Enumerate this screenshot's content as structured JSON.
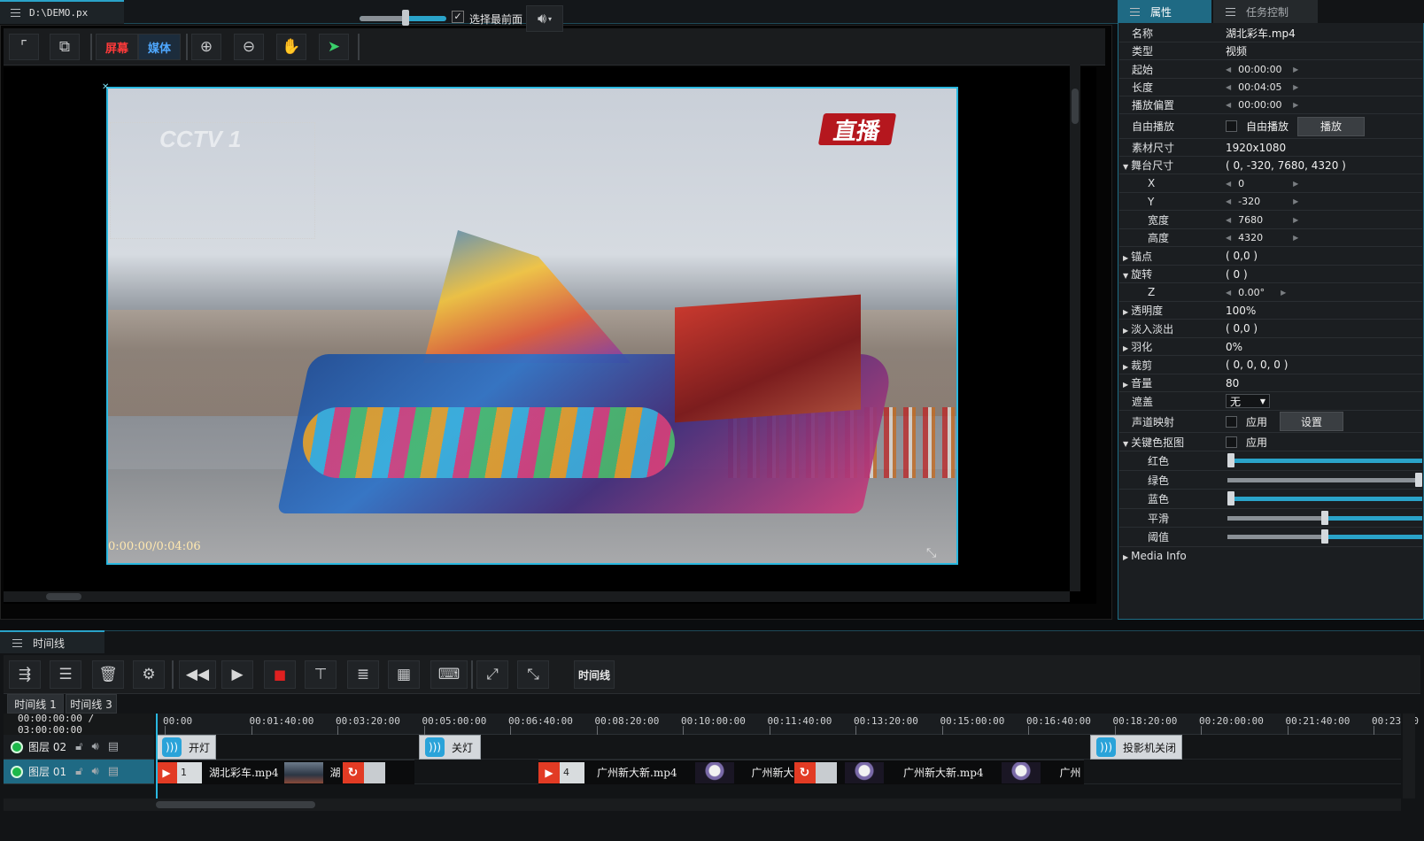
{
  "document_tab": {
    "title": "D:\\DEMO.px"
  },
  "toolbar": {
    "screen_label": "屏幕",
    "media_label": "媒体",
    "zoom_level_fraction": 0.5,
    "select_front_label": "选择最前面",
    "select_front_checked": true
  },
  "preview": {
    "timecode": "0:00:00/0:04:06",
    "live_logo_text": "直播",
    "cctv_logo_text": "CCTV 1"
  },
  "props_tabs": {
    "properties": "属性",
    "task_control": "任务控制"
  },
  "props": {
    "name": {
      "label": "名称",
      "value": "湖北彩车.mp4"
    },
    "type": {
      "label": "类型",
      "value": "视频"
    },
    "start": {
      "label": "起始",
      "value": "00:00:00"
    },
    "length": {
      "label": "长度",
      "value": "00:04:05"
    },
    "play_offset": {
      "label": "播放偏置",
      "value": "00:00:00"
    },
    "free_play": {
      "label": "自由播放",
      "check_label": "自由播放",
      "button": "播放"
    },
    "media_size": {
      "label": "素材尺寸",
      "value": "1920x1080"
    },
    "stage_size": {
      "label": "舞台尺寸",
      "value": "( 0, -320, 7680, 4320 )"
    },
    "x": {
      "label": "X",
      "value": "0"
    },
    "y": {
      "label": "Y",
      "value": "-320"
    },
    "width": {
      "label": "宽度",
      "value": "7680"
    },
    "height": {
      "label": "高度",
      "value": "4320"
    },
    "anchor": {
      "label": "锚点",
      "value": "( 0,0 )"
    },
    "rotation": {
      "label": "旋转",
      "value": "( 0 )"
    },
    "z": {
      "label": "Z",
      "value": "0.00°"
    },
    "opacity": {
      "label": "透明度",
      "value": "100%"
    },
    "fade": {
      "label": "淡入淡出",
      "value": "( 0,0 )"
    },
    "feather": {
      "label": "羽化",
      "value": "0%"
    },
    "crop": {
      "label": "裁剪",
      "value": "( 0, 0, 0, 0 )"
    },
    "volume": {
      "label": "音量",
      "value": "80"
    },
    "mask": {
      "label": "遮盖",
      "value": "无"
    },
    "channel_map": {
      "label": "声道映射",
      "check_label": "应用",
      "button": "设置"
    },
    "chroma_key": {
      "label": "关键色抠图",
      "check_label": "应用"
    },
    "red": {
      "label": "红色",
      "level": 0.0
    },
    "green": {
      "label": "绿色",
      "level": 1.0
    },
    "blue": {
      "label": "蓝色",
      "level": 0.0
    },
    "smooth": {
      "label": "平滑",
      "level": 0.5
    },
    "threshold": {
      "label": "阈值",
      "level": 0.5
    },
    "media_info": {
      "label": "Media Info"
    }
  },
  "timeline_tab": {
    "title": "时间线"
  },
  "timeline_toolbar": {
    "timeline_button": "时间线"
  },
  "timeline_tabs": [
    "时间线 1",
    "时间线 3"
  ],
  "timeline": {
    "time_readout": "00:00:00:00 / 03:00:00:00",
    "ticks": [
      "00:00",
      "00:01:40:00",
      "00:03:20:00",
      "00:05:00:00",
      "00:06:40:00",
      "00:08:20:00",
      "00:10:00:00",
      "00:11:40:00",
      "00:13:20:00",
      "00:15:00:00",
      "00:16:40:00",
      "00:18:20:00",
      "00:20:00:00",
      "00:21:40:00",
      "00:23:20"
    ],
    "layers": [
      {
        "name": "图层 02"
      },
      {
        "name": "图层 01"
      }
    ],
    "light_clips": [
      "开灯",
      "关灯",
      "投影机关闭"
    ],
    "media_clips": [
      {
        "num": "1",
        "name": "湖北彩车.mp4",
        "tail": "湖"
      },
      {
        "num": "4",
        "name": "广州新大新.mp4",
        "tail": "广州新大"
      },
      {
        "num": "",
        "name": "广州新大新.mp4",
        "tail": "广州"
      }
    ]
  },
  "colors": {
    "accent": "#2aa3c9",
    "panel": "#1b1e21",
    "clip_red": "#e23b24"
  }
}
